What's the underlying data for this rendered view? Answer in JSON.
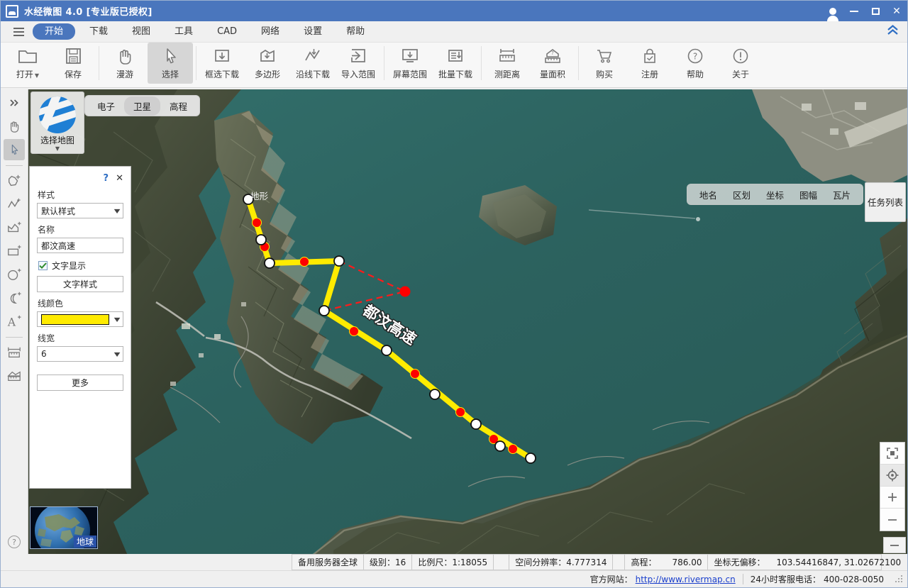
{
  "window": {
    "title": "水经微图 4.0 [专业版已授权]",
    "logo_icon": "app-logo-icon",
    "account_icon": "user-account-icon",
    "minimize_icon": "minimize-icon",
    "maximize_icon": "maximize-icon",
    "close_icon": "close-icon"
  },
  "menubar": {
    "hamburger_icon": "hamburger-menu-icon",
    "collapse_icon": "chevron-double-up-icon",
    "items": [
      {
        "label": "开始",
        "active": true
      },
      {
        "label": "下载",
        "active": false
      },
      {
        "label": "视图",
        "active": false
      },
      {
        "label": "工具",
        "active": false
      },
      {
        "label": "CAD",
        "active": false
      },
      {
        "label": "网络",
        "active": false
      },
      {
        "label": "设置",
        "active": false
      },
      {
        "label": "帮助",
        "active": false
      }
    ]
  },
  "ribbon": {
    "groups": [
      {
        "buttons": [
          {
            "label": "打开",
            "icon": "folder-open-icon",
            "caret": true,
            "selected": false
          },
          {
            "label": "保存",
            "icon": "save-disk-icon",
            "caret": false,
            "selected": false
          }
        ]
      },
      {
        "buttons": [
          {
            "label": "漫游",
            "icon": "hand-pan-icon",
            "caret": false,
            "selected": false
          },
          {
            "label": "选择",
            "icon": "cursor-arrow-icon",
            "caret": false,
            "selected": true
          }
        ]
      },
      {
        "buttons": [
          {
            "label": "框选下载",
            "icon": "rect-download-icon",
            "caret": false,
            "selected": false
          },
          {
            "label": "多边形",
            "icon": "polygon-download-icon",
            "caret": false,
            "selected": false
          },
          {
            "label": "沿线下载",
            "icon": "polyline-download-icon",
            "caret": false,
            "selected": false
          },
          {
            "label": "导入范围",
            "icon": "import-range-icon",
            "caret": false,
            "selected": false
          }
        ]
      },
      {
        "buttons": [
          {
            "label": "屏幕范围",
            "icon": "screen-range-icon",
            "caret": false,
            "selected": false
          },
          {
            "label": "批量下载",
            "icon": "batch-download-icon",
            "caret": false,
            "selected": false
          }
        ]
      },
      {
        "buttons": [
          {
            "label": "测距离",
            "icon": "measure-distance-icon",
            "caret": false,
            "selected": false
          },
          {
            "label": "量面积",
            "icon": "measure-area-icon",
            "caret": false,
            "selected": false
          }
        ]
      },
      {
        "buttons": [
          {
            "label": "购买",
            "icon": "shopping-cart-icon",
            "caret": false,
            "selected": false
          },
          {
            "label": "注册",
            "icon": "lock-register-icon",
            "caret": false,
            "selected": false
          },
          {
            "label": "帮助",
            "icon": "question-circle-icon",
            "caret": false,
            "selected": false
          },
          {
            "label": "关于",
            "icon": "info-circle-icon",
            "caret": false,
            "selected": false
          }
        ]
      }
    ]
  },
  "toolstrip": {
    "items": [
      {
        "icon": "expand-right-icon",
        "name": "expand-panel",
        "selected": false
      },
      {
        "icon": "hand-pan-icon",
        "name": "pan-tool",
        "selected": false
      },
      {
        "icon": "cursor-arrow-icon",
        "name": "select-tool",
        "selected": true
      },
      {
        "sep": true
      },
      {
        "icon": "add-polygon-icon",
        "name": "add-polygon-tool",
        "selected": false
      },
      {
        "icon": "add-polyline-icon",
        "name": "add-polyline-tool",
        "selected": false
      },
      {
        "icon": "add-area-icon",
        "name": "add-area-tool",
        "selected": false
      },
      {
        "icon": "add-rectangle-icon",
        "name": "add-rectangle-tool",
        "selected": false
      },
      {
        "icon": "add-circle-icon",
        "name": "add-circle-tool",
        "selected": false
      },
      {
        "icon": "add-arc-icon",
        "name": "add-arc-tool",
        "selected": false
      },
      {
        "icon": "add-text-icon",
        "name": "add-text-tool",
        "selected": false
      },
      {
        "sep": true
      },
      {
        "icon": "ruler-icon",
        "name": "ruler-tool",
        "selected": false
      },
      {
        "icon": "elevation-profile-icon",
        "name": "elevation-profile-tool",
        "selected": false
      }
    ],
    "help_icon": "question-circle-icon"
  },
  "map": {
    "select_map": {
      "label": "选择地图",
      "icon": "earth-globe-icon",
      "caret_icon": "caret-down-icon"
    },
    "layer_tabs": [
      {
        "label": "电子",
        "active": false
      },
      {
        "label": "卫星",
        "active": true
      },
      {
        "label": "高程",
        "active": false
      }
    ],
    "layer_tab_outside": {
      "label": "地形",
      "icon": "terrain-icon"
    },
    "right_tabs": [
      {
        "label": "地名"
      },
      {
        "label": "区划"
      },
      {
        "label": "坐标"
      },
      {
        "label": "图幅"
      },
      {
        "label": "瓦片"
      }
    ],
    "task_list": {
      "label": "任务列表"
    },
    "zoom_controls": [
      {
        "icon": "fullscreen-icon",
        "name": "fullscreen-button",
        "glyph": "⛶",
        "active": false
      },
      {
        "icon": "locate-crosshair-icon",
        "name": "locate-button",
        "glyph": "◉",
        "active": true
      },
      {
        "icon": "zoom-in-icon",
        "name": "zoom-in-button",
        "glyph": "+",
        "active": false
      },
      {
        "icon": "zoom-out-icon",
        "name": "zoom-out-button",
        "glyph": "−",
        "active": false
      }
    ],
    "minimap": {
      "label": "地球",
      "icon": "earth-thumbnail-icon"
    },
    "feature_label": "都汶高速",
    "colors": {
      "water": "#2e6461",
      "line": "#ffeb00",
      "vertex_fill": "#ffffff",
      "midpoint_fill": "#ff0000",
      "guide_line": "#ff1a1a"
    }
  },
  "style_panel": {
    "help_icon": "question-mark-icon",
    "close_icon": "close-icon",
    "style_label": "样式",
    "style_value": "默认样式",
    "name_label": "名称",
    "name_value": "都汶高速",
    "name_placeholder": "名称",
    "text_display_label": "文字显示",
    "text_display_checked": true,
    "text_style_button": "文字样式",
    "line_color_label": "线颜色",
    "line_color_value": "#ffeb00",
    "line_width_label": "线宽",
    "line_width_value": "6",
    "more_button": "更多"
  },
  "statusbar": {
    "server": "备用服务器全球",
    "level_label": "级别：",
    "level_value": "16",
    "scale_label": "比例尺：",
    "scale_value": "1:18055",
    "resolution_label": "空间分辨率：",
    "resolution_value": "4.777314",
    "elevation_label": "高程：",
    "elevation_value": "786.00",
    "coord_label": "坐标无偏移：",
    "coord_value": "103.54416847, 31.02672100",
    "collapse_icon": "minus-icon"
  },
  "footer": {
    "site_label": "官方网站：",
    "site_url": "http://www.rivermap.cn",
    "support_label": "24小时客服电话：",
    "support_value": "400-028-0050",
    "resize_grip_icon": "resize-grip-icon"
  }
}
